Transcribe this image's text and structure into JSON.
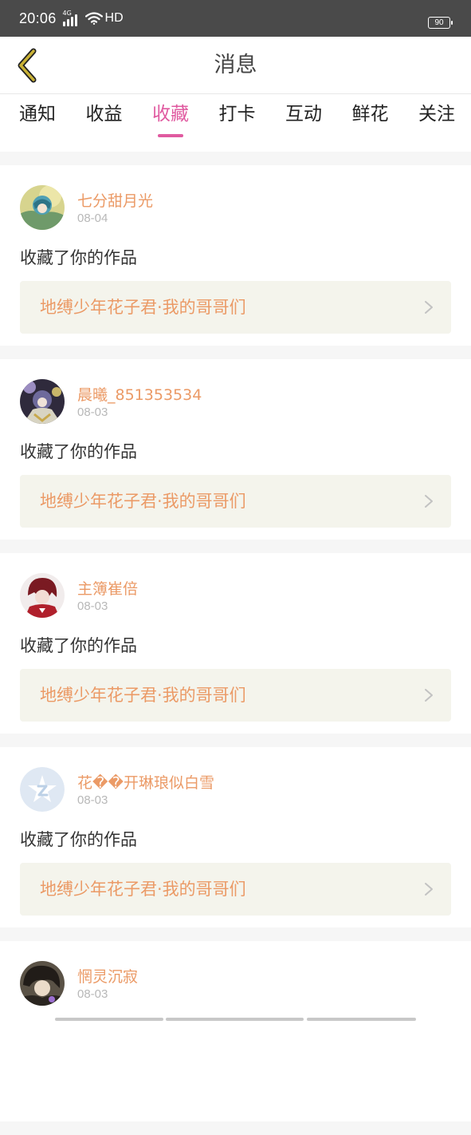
{
  "status_bar": {
    "time": "20:06",
    "network": "4G",
    "hd": "HD",
    "battery": "90"
  },
  "header": {
    "title": "消息"
  },
  "tabs": [
    {
      "label": "通知",
      "active": false
    },
    {
      "label": "收益",
      "active": false
    },
    {
      "label": "收藏",
      "active": true
    },
    {
      "label": "打卡",
      "active": false
    },
    {
      "label": "互动",
      "active": false
    },
    {
      "label": "鲜花",
      "active": false
    },
    {
      "label": "关注",
      "active": false
    }
  ],
  "messages": [
    {
      "user": "七分甜月光",
      "date": "08-04",
      "action": "收藏了你的作品",
      "work": "地缚少年花子君·我的哥哥们"
    },
    {
      "user": "晨曦_851353534",
      "date": "08-03",
      "action": "收藏了你的作品",
      "work": "地缚少年花子君·我的哥哥们"
    },
    {
      "user": "主簿崔倍",
      "date": "08-03",
      "action": "收藏了你的作品",
      "work": "地缚少年花子君·我的哥哥们"
    },
    {
      "user": "花��开琳琅似白雪",
      "date": "08-03",
      "action": "收藏了你的作品",
      "work": "地缚少年花子君·我的哥哥们"
    },
    {
      "user": "惘灵沉寂",
      "date": "08-03",
      "action": "",
      "work": ""
    }
  ],
  "colors": {
    "accent": "#e05aa0",
    "username": "#eb9a66",
    "status_bar": "#4a4a4a",
    "back_icon": "#c9b236",
    "work_card_bg": "#f4f4ec"
  }
}
